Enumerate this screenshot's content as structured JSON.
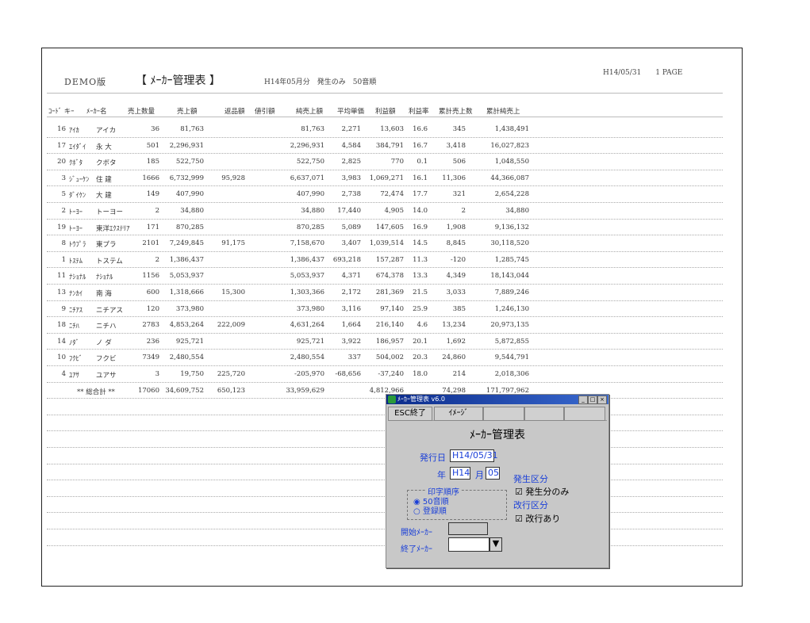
{
  "report": {
    "demo_label": "DEMO版",
    "title": "【 ﾒｰｶｰ管理表 】",
    "conditions": "H14年05月分　発生のみ　50音順",
    "print_date_page": "H14/05/31　　1 PAGE"
  },
  "columns": [
    "ｺｰﾄﾞ キｰ",
    "ﾒｰｶｰ名",
    "売上数量",
    "売上額",
    "返品額",
    "値引額",
    "純売上額",
    "平均単価",
    "利益額",
    "利益率",
    "累計売上数",
    "累計純売上"
  ],
  "rows": [
    [
      "16",
      "ｱｲｶ",
      "アイカ",
      "36",
      "81,763",
      "",
      "",
      "81,763",
      "2,271",
      "13,603",
      "16.6",
      "345",
      "1,438,491"
    ],
    [
      "17",
      "ｴｲﾀﾞｲ",
      "永 大",
      "501",
      "2,296,931",
      "",
      "",
      "2,296,931",
      "4,584",
      "384,791",
      "16.7",
      "3,418",
      "16,027,823"
    ],
    [
      "20",
      "ｸﾎﾞﾀ",
      "クボタ",
      "185",
      "522,750",
      "",
      "",
      "522,750",
      "2,825",
      "770",
      "0.1",
      "506",
      "1,048,550"
    ],
    [
      "3",
      "ｼﾞｭｰｹﾝ",
      "住 建",
      "1666",
      "6,732,999",
      "95,928",
      "",
      "6,637,071",
      "3,983",
      "1,069,271",
      "16.1",
      "11,306",
      "44,366,087"
    ],
    [
      "5",
      "ﾀﾞｲｹﾝ",
      "大 建",
      "149",
      "407,990",
      "",
      "",
      "407,990",
      "2,738",
      "72,474",
      "17.7",
      "321",
      "2,654,228"
    ],
    [
      "2",
      "ﾄｰﾖｰ",
      "トーヨー",
      "2",
      "34,880",
      "",
      "",
      "34,880",
      "17,440",
      "4,905",
      "14.0",
      "2",
      "34,880"
    ],
    [
      "19",
      "ﾄｰﾖｰ",
      "東洋ｴｸｽﾃﾘｱ",
      "171",
      "870,285",
      "",
      "",
      "870,285",
      "5,089",
      "147,605",
      "16.9",
      "1,908",
      "9,136,132"
    ],
    [
      "8",
      "ﾄｳﾌﾟﾗ",
      "東プラ",
      "2101",
      "7,249,845",
      "91,175",
      "",
      "7,158,670",
      "3,407",
      "1,039,514",
      "14.5",
      "8,845",
      "30,118,520"
    ],
    [
      "1",
      "ﾄｽﾃﾑ",
      "トステム",
      "2",
      "1,386,437",
      "",
      "",
      "1,386,437",
      "693,218",
      "157,287",
      "11.3",
      "-120",
      "1,285,745"
    ],
    [
      "11",
      "ﾅｼｮﾅﾙ",
      "ﾅｼｮﾅﾙ",
      "1156",
      "5,053,937",
      "",
      "",
      "5,053,937",
      "4,371",
      "674,378",
      "13.3",
      "4,349",
      "18,143,044"
    ],
    [
      "13",
      "ﾅﾝｶｲ",
      "南 海",
      "600",
      "1,318,666",
      "15,300",
      "",
      "1,303,366",
      "2,172",
      "281,369",
      "21.5",
      "3,033",
      "7,889,246"
    ],
    [
      "9",
      "ﾆﾁｱｽ",
      "ニチアス",
      "120",
      "373,980",
      "",
      "",
      "373,980",
      "3,116",
      "97,140",
      "25.9",
      "385",
      "1,246,130"
    ],
    [
      "18",
      "ﾆﾁﾊ",
      "ニチハ",
      "2783",
      "4,853,264",
      "222,009",
      "",
      "4,631,264",
      "1,664",
      "216,140",
      "4.6",
      "13,234",
      "20,973,135"
    ],
    [
      "14",
      "ﾉﾀﾞ",
      "ノ ダ",
      "236",
      "925,721",
      "",
      "",
      "925,721",
      "3,922",
      "186,957",
      "20.1",
      "1,692",
      "5,872,855"
    ],
    [
      "10",
      "ﾌｸﾋﾞ",
      "フクビ",
      "7349",
      "2,480,554",
      "",
      "",
      "2,480,554",
      "337",
      "504,002",
      "20.3",
      "24,860",
      "9,544,791"
    ],
    [
      "4",
      "ﾕｱｻ",
      "ユアサ",
      "3",
      "19,750",
      "225,720",
      "",
      "-205,970",
      "-68,656",
      "-37,240",
      "18.0",
      "214",
      "2,018,306"
    ]
  ],
  "total": {
    "label": "** 総合計 **",
    "qty": "17060",
    "sales": "34,609,752",
    "returns": "650,123",
    "net": "33,959,629",
    "profit": "4,812,966",
    "cum_qty": "74,298",
    "cum_net": "171,797,962"
  },
  "dialog": {
    "window_title": "ﾒｰｶｰ管理表 v6.0",
    "esc_button": "ESC終了",
    "image_button": "ｲﾒｰｼﾞ",
    "heading": "ﾒｰｶｰ管理表",
    "issue_date_label": "発行日",
    "issue_date_value": "H14/05/31",
    "year_label": "年",
    "year_value": "H14",
    "month_label": "月",
    "month_value": "05",
    "occurrence_label": "発生区分",
    "occurrence_check": "発生分のみ",
    "print_order_label": "印字順序",
    "order_opt1": "50音順",
    "order_opt2": "登録順",
    "page_break_label": "改行区分",
    "page_break_check": "改行あり",
    "start_maker_label": "開始ﾒｰｶｰ",
    "end_maker_label": "終了ﾒｰｶｰ"
  }
}
